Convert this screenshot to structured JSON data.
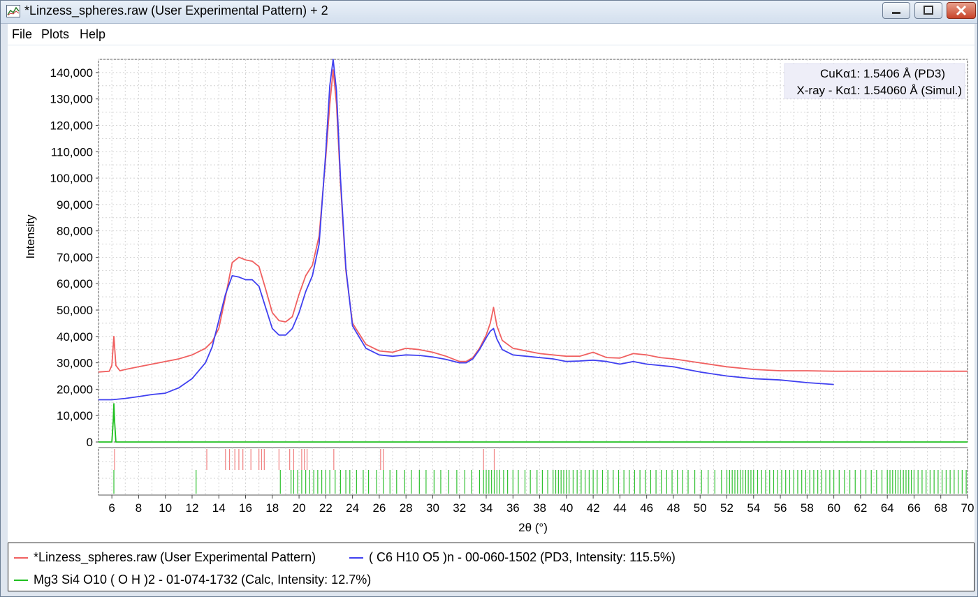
{
  "window": {
    "title": "*Linzess_spheres.raw (User Experimental Pattern) + 2",
    "buttons": [
      "minimize",
      "maximize",
      "close"
    ]
  },
  "menu": {
    "items": [
      "File",
      "Plots",
      "Help"
    ]
  },
  "info_box": {
    "line1": "CuKα1: 1.5406 Å (PD3)",
    "line2": "X-ray - Kα1: 1.54060 Å (Simul.)"
  },
  "legend": {
    "items": [
      {
        "label": "*Linzess_spheres.raw (User Experimental Pattern)",
        "color": "#f06060"
      },
      {
        "label": "( C6 H10 O5 )n - 00-060-1502 (PD3, Intensity: 115.5%)",
        "color": "#4040f0"
      },
      {
        "label": "Mg3 Si4 O10 ( O H )2 - 01-074-1732 (Calc, Intensity: 12.7%)",
        "color": "#20c020"
      }
    ]
  },
  "chart_data": {
    "type": "line",
    "xlabel": "2θ (°)",
    "ylabel": "Intensity",
    "xlim": [
      5,
      70
    ],
    "ylim": [
      0,
      145000
    ],
    "grid": true,
    "x_ticks": [
      6,
      8,
      10,
      12,
      14,
      16,
      18,
      20,
      22,
      24,
      26,
      28,
      30,
      32,
      34,
      36,
      38,
      40,
      42,
      44,
      46,
      48,
      50,
      52,
      54,
      56,
      58,
      60,
      62,
      64,
      66,
      68,
      70
    ],
    "y_ticks": [
      0,
      10000,
      20000,
      30000,
      40000,
      50000,
      60000,
      70000,
      80000,
      90000,
      100000,
      110000,
      120000,
      130000,
      140000
    ],
    "y_tick_labels": [
      "0",
      "10,000",
      "20,000",
      "30,000",
      "40,000",
      "50,000",
      "60,000",
      "70,000",
      "80,000",
      "90,000",
      "100,000",
      "110,000",
      "120,000",
      "130,000",
      "140,000"
    ],
    "series": [
      {
        "name": "*Linzess_spheres.raw (User Experimental Pattern)",
        "color": "#f06060",
        "x": [
          5,
          5.8,
          6.0,
          6.15,
          6.3,
          6.6,
          7,
          8,
          9,
          10,
          11,
          12,
          13,
          13.5,
          14,
          14.5,
          15,
          15.5,
          16,
          16.5,
          17,
          17.5,
          18,
          18.5,
          19,
          19.5,
          20,
          20.5,
          21,
          21.5,
          22,
          22.3,
          22.55,
          22.8,
          23.1,
          23.5,
          24,
          25,
          26,
          27,
          28,
          29,
          30,
          31,
          32,
          32.5,
          33,
          33.5,
          34,
          34.3,
          34.55,
          34.8,
          35.2,
          36,
          37,
          38,
          39,
          40,
          41,
          42,
          43,
          44,
          45,
          46,
          47,
          48,
          50,
          52,
          54,
          56,
          58,
          60,
          62,
          64,
          66,
          68,
          70
        ],
        "y": [
          26500,
          26800,
          29000,
          40000,
          29000,
          27000,
          27500,
          28500,
          29500,
          30500,
          31500,
          33000,
          35500,
          38000,
          43000,
          55000,
          68000,
          70000,
          69000,
          68500,
          66500,
          58000,
          49000,
          46000,
          45500,
          47500,
          56000,
          63000,
          67000,
          78000,
          108000,
          128000,
          141000,
          128000,
          98000,
          65000,
          45000,
          37000,
          34500,
          34000,
          35500,
          35000,
          34000,
          32500,
          30500,
          30500,
          32000,
          35500,
          40500,
          45000,
          51000,
          44000,
          38500,
          35500,
          34500,
          33500,
          33000,
          32500,
          32500,
          34000,
          32000,
          31800,
          33500,
          33000,
          32000,
          31500,
          30000,
          28500,
          27500,
          27000,
          27000,
          26800,
          26800,
          26800,
          26800,
          26800,
          26800
        ]
      },
      {
        "name": "( C6 H10 O5 )n - 00-060-1502 (PD3, Intensity: 115.5%)",
        "color": "#4040f0",
        "x": [
          5,
          6,
          7,
          8,
          9,
          10,
          11,
          12,
          13,
          13.5,
          14,
          14.5,
          15,
          15.5,
          16,
          16.5,
          17,
          17.5,
          18,
          18.5,
          19,
          19.5,
          20,
          20.5,
          21,
          21.5,
          22,
          22.3,
          22.55,
          22.8,
          23.1,
          23.5,
          24,
          25,
          26,
          27,
          28,
          29,
          30,
          31,
          32,
          32.5,
          33,
          33.5,
          34,
          34.3,
          34.55,
          34.8,
          35.2,
          36,
          37,
          38,
          39,
          40,
          41,
          42,
          43,
          44,
          45,
          46,
          47,
          48,
          49,
          50,
          52,
          54,
          56,
          58,
          60
        ],
        "y": [
          16000,
          16000,
          16500,
          17200,
          18000,
          18500,
          20500,
          24000,
          30000,
          36000,
          46000,
          56000,
          63000,
          62500,
          61500,
          61500,
          59000,
          51000,
          43000,
          40500,
          40500,
          43000,
          49000,
          57000,
          63000,
          75000,
          110000,
          135000,
          145000,
          133000,
          100000,
          66000,
          44000,
          35500,
          33000,
          32500,
          33000,
          32800,
          32200,
          31300,
          30000,
          30000,
          31500,
          35000,
          39500,
          42000,
          43000,
          39000,
          35000,
          33000,
          32500,
          32000,
          31500,
          30500,
          30700,
          31000,
          30500,
          29500,
          30500,
          29500,
          29000,
          28500,
          27500,
          26500,
          25000,
          24000,
          23500,
          22500,
          21800
        ]
      },
      {
        "name": "Mg3 Si4 O10 ( O H )2 - 01-074-1732 (Calc, Intensity: 12.7%)",
        "color": "#20c020",
        "x": [
          5,
          6.0,
          6.1,
          6.15,
          6.2,
          6.3,
          7,
          10,
          20,
          30,
          40,
          50,
          60,
          70
        ],
        "y": [
          0,
          0,
          8000,
          14500,
          8000,
          0,
          0,
          0,
          0,
          0,
          0,
          0,
          0,
          0
        ]
      }
    ],
    "reference_ticks": [
      {
        "name": "( C6 H10 O5 )n - 00-060-1502",
        "color": "#f08080",
        "positions": [
          6.2,
          13.1,
          14.5,
          14.8,
          15.2,
          15.5,
          15.8,
          16.4,
          17.0,
          17.2,
          17.4,
          18.5,
          19.3,
          19.6,
          20.2,
          20.4,
          20.6,
          22.6,
          26.1,
          26.3,
          33.8,
          34.6
        ]
      },
      {
        "name": "Mg3 Si4 O10 ( O H )2 - 01-074-1732",
        "color": "#30c030",
        "positions": [
          6.15,
          12.3,
          18.6,
          19.4,
          19.6,
          19.9,
          20.2,
          20.5,
          20.8,
          21.1,
          21.4,
          21.7,
          22.0,
          22.3,
          22.7,
          23.1,
          23.5,
          23.8,
          24.3,
          24.8,
          25.2,
          25.8,
          26.3,
          26.8,
          27.3,
          27.9,
          28.4,
          29.0,
          29.5,
          30.1,
          30.6,
          31.2,
          31.8,
          32.4,
          32.9,
          33.5,
          33.8,
          34.0,
          34.2,
          34.4,
          34.6,
          34.8,
          35.0,
          35.3,
          35.6,
          36.0,
          36.4,
          36.9,
          37.3,
          37.8,
          38.2,
          38.6,
          39.0,
          39.2,
          39.4,
          39.6,
          39.8,
          40.0,
          40.2,
          40.5,
          40.8,
          41.1,
          41.4,
          41.7,
          42.0,
          42.3,
          42.7,
          43.1,
          43.5,
          43.9,
          44.3,
          44.7,
          45.1,
          45.5,
          45.9,
          46.3,
          46.7,
          47.1,
          47.5,
          47.9,
          48.3,
          48.7,
          49.1,
          49.6,
          50.1,
          50.6,
          51.1,
          51.6,
          52.0,
          52.2,
          52.4,
          52.6,
          52.8,
          53.0,
          53.2,
          53.4,
          53.6,
          53.8,
          54.0,
          54.3,
          54.6,
          54.9,
          55.2,
          55.5,
          55.8,
          56.1,
          56.4,
          56.7,
          57.0,
          57.3,
          57.6,
          57.9,
          58.2,
          58.5,
          58.8,
          59.1,
          59.4,
          59.7,
          60.0,
          60.4,
          60.8,
          61.2,
          61.6,
          62.0,
          62.4,
          62.8,
          63.2,
          63.6,
          64.0,
          64.2,
          64.4,
          64.6,
          64.8,
          65.0,
          65.2,
          65.4,
          65.6,
          65.8,
          66.0,
          66.3,
          66.6,
          66.9,
          67.2,
          67.5,
          67.8,
          68.1,
          68.4,
          68.7,
          69.0,
          69.3,
          69.6,
          69.9
        ]
      }
    ]
  }
}
